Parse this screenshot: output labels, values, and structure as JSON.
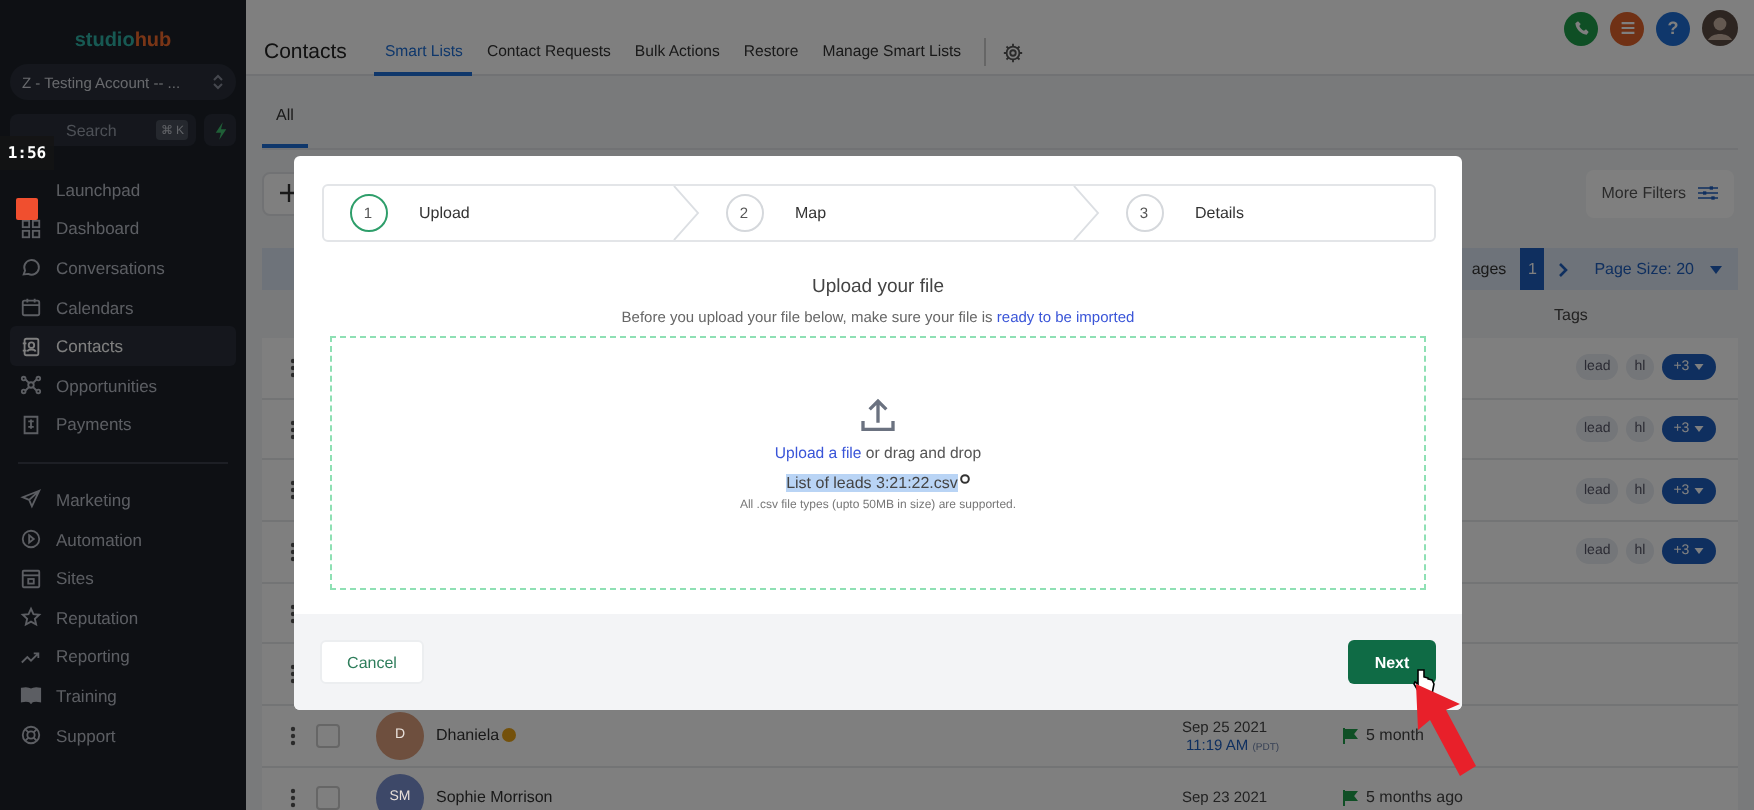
{
  "video_overlay": {
    "time": "1:56"
  },
  "topbar": {
    "help": "?"
  },
  "sidebar": {
    "logo": {
      "primary": "studio",
      "accent": "hub"
    },
    "account": "Z - Testing Account -- ...",
    "search": {
      "placeholder": "Search",
      "shortcut": "⌘ K"
    },
    "items": [
      {
        "label": "Launchpad",
        "selected": false
      },
      {
        "label": "Dashboard",
        "selected": false
      },
      {
        "label": "Conversations",
        "selected": false
      },
      {
        "label": "Calendars",
        "selected": false
      },
      {
        "label": "Contacts",
        "selected": true
      },
      {
        "label": "Opportunities",
        "selected": false
      },
      {
        "label": "Payments",
        "selected": false
      }
    ],
    "items_secondary": [
      {
        "label": "Marketing",
        "selected": false
      },
      {
        "label": "Automation",
        "selected": false
      },
      {
        "label": "Sites",
        "selected": false
      },
      {
        "label": "Reputation",
        "selected": false
      },
      {
        "label": "Reporting",
        "selected": false
      },
      {
        "label": "Training",
        "selected": false
      },
      {
        "label": "Support",
        "selected": false
      }
    ]
  },
  "header": {
    "title": "Contacts",
    "tabs": [
      {
        "label": "Smart Lists",
        "selected": true
      },
      {
        "label": "Contact Requests",
        "selected": false
      },
      {
        "label": "Bulk Actions",
        "selected": false
      },
      {
        "label": "Restore",
        "selected": false
      },
      {
        "label": "Manage Smart Lists",
        "selected": false
      }
    ]
  },
  "subtabs": [
    {
      "label": "All",
      "selected": true
    }
  ],
  "filters": {
    "more_filters": "More Filters"
  },
  "pagination": {
    "label": "ages",
    "pages": [
      {
        "label": "1",
        "selected": true
      }
    ],
    "page_size": "Page Size: 20"
  },
  "table": {
    "columns": [
      "Tags"
    ],
    "rows": [
      {
        "kind": "tagged",
        "tags": [
          "lead",
          "hl"
        ],
        "more_tags": "+3"
      },
      {
        "kind": "tagged",
        "tags": [
          "lead",
          "hl"
        ],
        "more_tags": "+3"
      },
      {
        "kind": "tagged",
        "tags": [
          "lead",
          "hl"
        ],
        "more_tags": "+3"
      },
      {
        "kind": "tagged",
        "tags": [
          "lead",
          "hl"
        ],
        "more_tags": "+3"
      },
      {
        "kind": "blank"
      },
      {
        "kind": "blank"
      },
      {
        "kind": "contact",
        "checked": false,
        "initials": "D",
        "name": "Dhaniela",
        "date": "Sep 25 2021",
        "time": "11:19 AM",
        "timezone": "(PDT)",
        "activity": "5 month",
        "color": "#6e4f3e"
      },
      {
        "kind": "contact",
        "checked": false,
        "initials": "SM",
        "name": "Sophie Morrison",
        "date": "Sep 23 2021",
        "activity": "5 months ago",
        "color": "#3d4868"
      }
    ]
  },
  "modal": {
    "steps": [
      {
        "number": "1",
        "label": "Upload",
        "selected": true
      },
      {
        "number": "2",
        "label": "Map",
        "selected": false
      },
      {
        "number": "3",
        "label": "Details",
        "selected": false
      }
    ],
    "title": "Upload your file",
    "subtitle": "Before you upload your file below, make sure your file is ",
    "subtitle_link": "ready to be imported",
    "upload_link": "Upload a file",
    "upload_text": " or drag and drop",
    "file": {
      "name": "List of leads 3:21:22.csv",
      "highlighted": true
    },
    "note": "All .csv file types (upto 50MB in size) are supported.",
    "cancel": "Cancel",
    "next": "Next"
  }
}
